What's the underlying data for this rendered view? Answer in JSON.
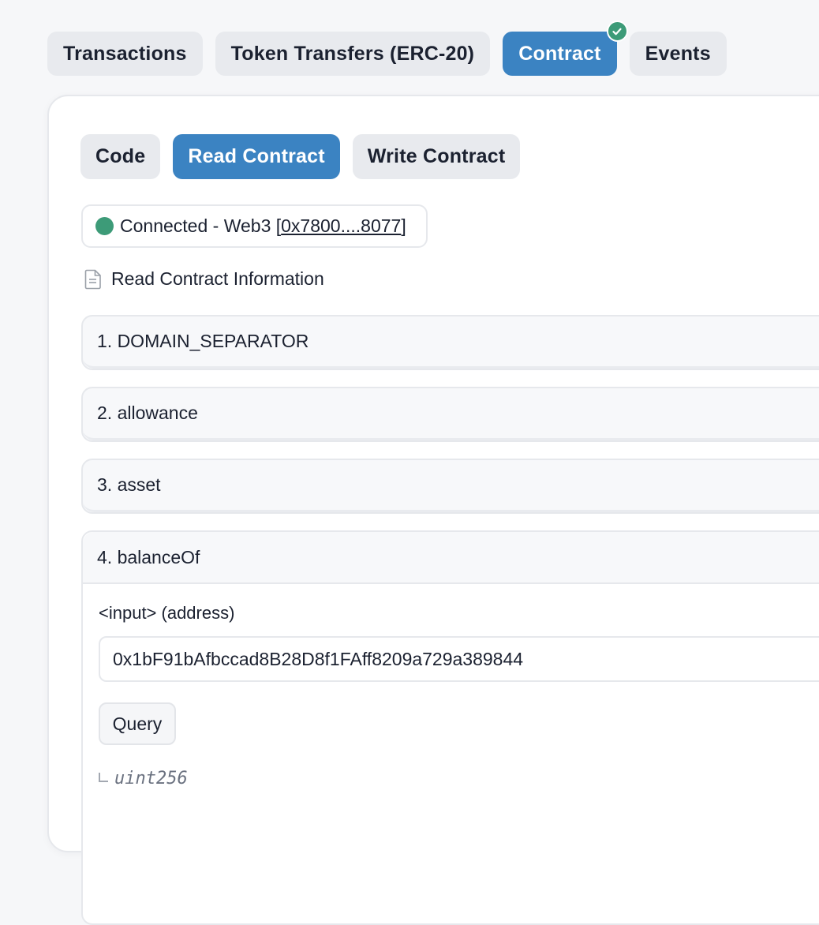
{
  "top_tabs": [
    {
      "label": "Transactions",
      "active": false
    },
    {
      "label": "Token Transfers (ERC-20)",
      "active": false
    },
    {
      "label": "Contract",
      "active": true,
      "icon": "verified-check-icon"
    },
    {
      "label": "Events",
      "active": false
    }
  ],
  "contract_tabs": [
    {
      "label": "Code",
      "active": false
    },
    {
      "label": "Read Contract",
      "active": true
    },
    {
      "label": "Write Contract",
      "active": false
    }
  ],
  "connection": {
    "status_prefix": "Connected - Web3 [",
    "address": "0x7800....8077",
    "status_suffix": "]",
    "status_color": "#3d9b78"
  },
  "section": {
    "title": "Read Contract Information",
    "icon": "document-icon"
  },
  "functions": [
    {
      "label": "1. DOMAIN_SEPARATOR",
      "expanded": false
    },
    {
      "label": "2. allowance",
      "expanded": false
    },
    {
      "label": "3. asset",
      "expanded": false
    },
    {
      "label": "4. balanceOf",
      "expanded": true,
      "input_label": "<input> (address)",
      "input_value": "0x1bF91bAfbccad8B28D8f1FAff8209a729a389844",
      "query_label": "Query",
      "return_type": "uint256"
    }
  ],
  "colors": {
    "accent": "#3b83c2",
    "success": "#3d9b78",
    "tab_bg": "#e8eaee"
  }
}
